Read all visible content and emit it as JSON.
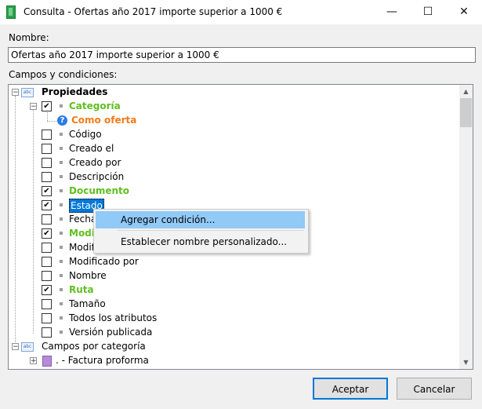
{
  "window": {
    "app": "Consulta",
    "title": "Consulta  - Ofertas año 2017 importe superior a 1000 €",
    "minimize": "—",
    "maximize": "☐",
    "close": "✕"
  },
  "form": {
    "name_label": "Nombre:",
    "name_value": "Ofertas año 2017 importe superior a 1000 €",
    "fields_label": "Campos y condiciones:"
  },
  "tree": {
    "root": "Propiedades",
    "categoria": "Categoría",
    "como_oferta": "Como oferta",
    "items": [
      {
        "label": "Código",
        "checked": false,
        "style": "normal"
      },
      {
        "label": "Creado el",
        "checked": false,
        "style": "normal"
      },
      {
        "label": "Creado por",
        "checked": false,
        "style": "normal"
      },
      {
        "label": "Descripción",
        "checked": false,
        "style": "normal"
      },
      {
        "label": "Documento",
        "checked": true,
        "style": "green"
      },
      {
        "label": "Estado",
        "checked": true,
        "style": "selected"
      },
      {
        "label": "Fecha",
        "checked": false,
        "style": "normal"
      },
      {
        "label": "Modif",
        "checked": true,
        "style": "green"
      },
      {
        "label": "Modif",
        "checked": false,
        "style": "normal"
      },
      {
        "label": "Modificado por",
        "checked": false,
        "style": "normal"
      },
      {
        "label": "Nombre",
        "checked": false,
        "style": "normal"
      },
      {
        "label": "Ruta",
        "checked": true,
        "style": "green"
      },
      {
        "label": "Tamaño",
        "checked": false,
        "style": "normal"
      },
      {
        "label": "Todos los atributos",
        "checked": false,
        "style": "normal"
      },
      {
        "label": "Versión publicada",
        "checked": false,
        "style": "normal"
      }
    ],
    "campos_por_categoria": "Campos por categoría",
    "factura": ". - Factura proforma"
  },
  "context_menu": {
    "add_condition": "Agregar condición...",
    "set_custom_name": "Establecer nombre personalizado..."
  },
  "buttons": {
    "accept": "Aceptar",
    "cancel": "Cancelar"
  },
  "colors": {
    "accent": "#0078d7",
    "green_text": "#5fc01f",
    "orange_text": "#f07c1a",
    "menu_highlight": "#91c9f7"
  }
}
